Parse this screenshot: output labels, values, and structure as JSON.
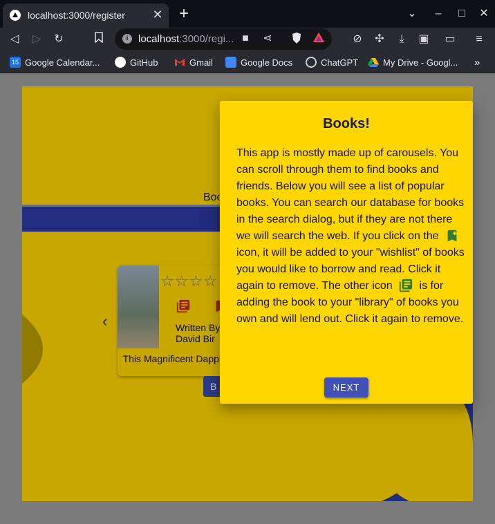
{
  "browser": {
    "tab_title": "localhost:3000/register",
    "url_host": "localhost",
    "url_rest": ":3000/regi...",
    "bookmarks": [
      {
        "label": "Google Calendar...",
        "icon": "google-calendar-icon",
        "color": "#1a73e8"
      },
      {
        "label": "GitHub",
        "icon": "github-icon",
        "color": "#ffffff"
      },
      {
        "label": "Gmail",
        "icon": "gmail-icon",
        "color": "#ea4335"
      },
      {
        "label": "Google Docs",
        "icon": "google-docs-icon",
        "color": "#4285f4"
      },
      {
        "label": "ChatGPT",
        "icon": "chatgpt-icon",
        "color": "#cfcfcf"
      },
      {
        "label": "My Drive - Googl...",
        "icon": "google-drive-icon",
        "color": "#fbbc04"
      }
    ]
  },
  "app": {
    "tab_label": "Boo",
    "card": {
      "author_prefix": "Written By",
      "author": "David Bir",
      "title": "This Magnificent Dappled Sea",
      "rating": 0,
      "max_rating": 5
    },
    "page_button": "B"
  },
  "dialog": {
    "title": "Books!",
    "body_part1": "This app is mostly made up of carousels. You can scroll through them to find books and friends. Below you will see a list of popular books. You can search our database for books in the search dialog, but if they are not there we will search the web. If you click on the",
    "body_part2": "icon, it will be added to your \"wishlist\" of books you would like to borrow and read. Click it again to remove. The other icon",
    "body_part3": "is for adding the book to your \"library\" of books you own and will lend out. Click it again to remove.",
    "next_label": "NEXT"
  },
  "colors": {
    "accent_yellow": "#ffd600",
    "primary_blue": "#3f51b5",
    "icon_green": "#2e7d32",
    "icon_red": "#c62828"
  }
}
